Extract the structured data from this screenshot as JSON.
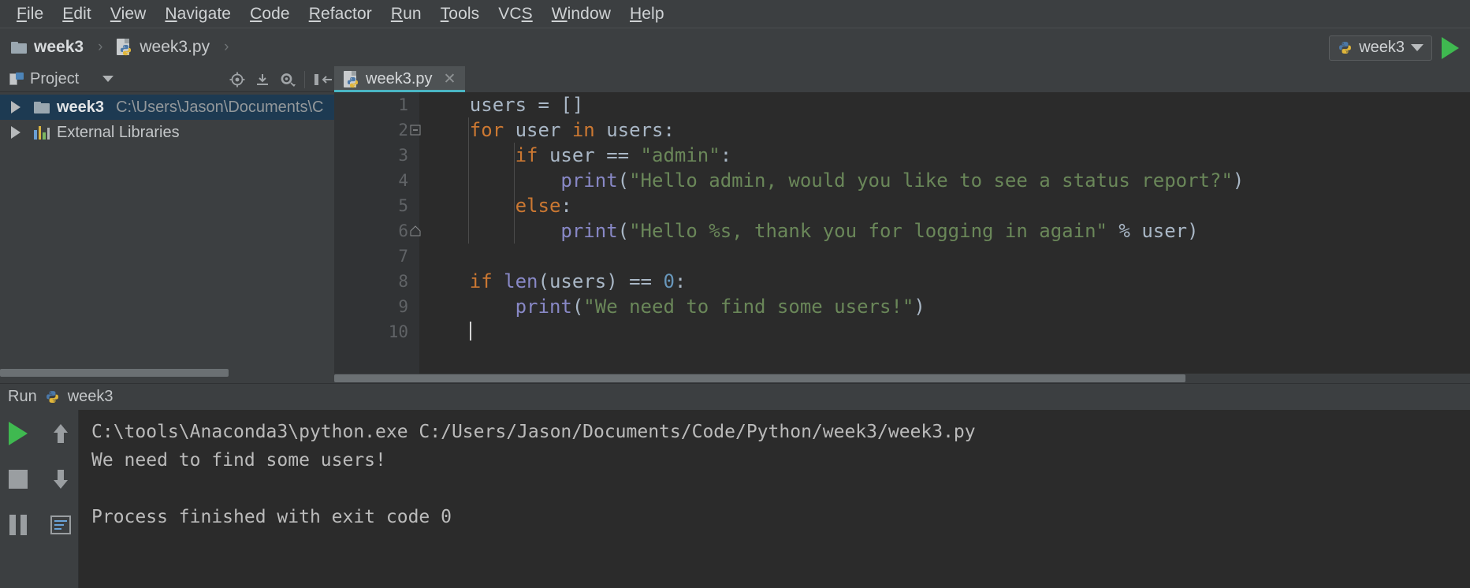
{
  "menubar": {
    "items": [
      {
        "label": "File",
        "mnemonic_index": 0
      },
      {
        "label": "Edit",
        "mnemonic_index": 0
      },
      {
        "label": "View",
        "mnemonic_index": 0
      },
      {
        "label": "Navigate",
        "mnemonic_index": 0
      },
      {
        "label": "Code",
        "mnemonic_index": 0
      },
      {
        "label": "Refactor",
        "mnemonic_index": 0
      },
      {
        "label": "Run",
        "mnemonic_index": 0
      },
      {
        "label": "Tools",
        "mnemonic_index": 0
      },
      {
        "label": "VCS",
        "mnemonic_index": 2
      },
      {
        "label": "Window",
        "mnemonic_index": 0
      },
      {
        "label": "Help",
        "mnemonic_index": 0
      }
    ]
  },
  "breadcrumb": {
    "separator": "›",
    "items": [
      {
        "label": "week3",
        "icon": "folder-icon",
        "bold": true
      },
      {
        "label": "week3.py",
        "icon": "python-file-icon",
        "bold": false
      }
    ]
  },
  "run_config": {
    "name": "week3",
    "icon": "python-icon",
    "dropdown_icon": "chevron-down-icon",
    "run_button_icon": "play-icon",
    "accent_green": "#3fb950"
  },
  "project_panel": {
    "title": "Project",
    "title_icon": "project-icon",
    "dropdown_icon": "chevron-down-icon",
    "toolbar_icons": [
      "locate-target-icon",
      "collapse-all-icon",
      "settings-gear-icon",
      "hide-panel-icon"
    ],
    "tree": [
      {
        "label": "week3",
        "path": "C:\\Users\\Jason\\Documents\\C",
        "icon": "folder-icon",
        "expander": "triangle-right-icon",
        "selected": true,
        "bold": true
      },
      {
        "label": "External Libraries",
        "path": "",
        "icon": "library-icon",
        "expander": "triangle-right-icon",
        "selected": false,
        "bold": false
      }
    ]
  },
  "editor": {
    "tabs": [
      {
        "label": "week3.py",
        "icon": "python-file-icon",
        "active": true,
        "close_icon": "close-icon"
      }
    ],
    "line_numbers": [
      "1",
      "2",
      "3",
      "4",
      "5",
      "6",
      "7",
      "8",
      "9",
      "10"
    ],
    "lines": [
      {
        "n": "1",
        "tokens": [
          {
            "t": "    users = []",
            "c": "plain"
          }
        ]
      },
      {
        "n": "2",
        "tokens": [
          {
            "t": "    ",
            "c": "plain"
          },
          {
            "t": "for",
            "c": "kw"
          },
          {
            "t": " user ",
            "c": "plain"
          },
          {
            "t": "in",
            "c": "kw"
          },
          {
            "t": " users:",
            "c": "plain"
          }
        ]
      },
      {
        "n": "3",
        "tokens": [
          {
            "t": "        ",
            "c": "plain"
          },
          {
            "t": "if",
            "c": "kw"
          },
          {
            "t": " user == ",
            "c": "plain"
          },
          {
            "t": "\"admin\"",
            "c": "str"
          },
          {
            "t": ":",
            "c": "plain"
          }
        ]
      },
      {
        "n": "4",
        "tokens": [
          {
            "t": "            ",
            "c": "plain"
          },
          {
            "t": "print",
            "c": "bif"
          },
          {
            "t": "(",
            "c": "plain"
          },
          {
            "t": "\"Hello admin, would you like to see a status report?\"",
            "c": "str"
          },
          {
            "t": ")",
            "c": "plain"
          }
        ]
      },
      {
        "n": "5",
        "tokens": [
          {
            "t": "        ",
            "c": "plain"
          },
          {
            "t": "else",
            "c": "kw"
          },
          {
            "t": ":",
            "c": "plain"
          }
        ]
      },
      {
        "n": "6",
        "tokens": [
          {
            "t": "            ",
            "c": "plain"
          },
          {
            "t": "print",
            "c": "bif"
          },
          {
            "t": "(",
            "c": "plain"
          },
          {
            "t": "\"Hello %s, thank you for logging in again\"",
            "c": "str"
          },
          {
            "t": " % user)",
            "c": "plain"
          }
        ]
      },
      {
        "n": "7",
        "tokens": [
          {
            "t": "",
            "c": "plain"
          }
        ]
      },
      {
        "n": "8",
        "tokens": [
          {
            "t": "    ",
            "c": "plain"
          },
          {
            "t": "if",
            "c": "kw"
          },
          {
            "t": " ",
            "c": "plain"
          },
          {
            "t": "len",
            "c": "bif"
          },
          {
            "t": "(users) == ",
            "c": "plain"
          },
          {
            "t": "0",
            "c": "num"
          },
          {
            "t": ":",
            "c": "plain"
          }
        ]
      },
      {
        "n": "9",
        "tokens": [
          {
            "t": "        ",
            "c": "plain"
          },
          {
            "t": "print",
            "c": "bif"
          },
          {
            "t": "(",
            "c": "plain"
          },
          {
            "t": "\"We need to find some users!\"",
            "c": "str"
          },
          {
            "t": ")",
            "c": "plain"
          }
        ]
      },
      {
        "n": "10",
        "tokens": [
          {
            "t": "    ",
            "c": "plain"
          }
        ]
      }
    ],
    "colors": {
      "background": "#2b2b2b",
      "gutter": "#313335",
      "plain": "#a9b7c6",
      "keyword": "#cc7832",
      "string": "#6a8759",
      "builtin": "#8888c6",
      "number": "#6897bb",
      "tab_underline": "#4ab6c4"
    },
    "fold_markers": [
      {
        "line": "2",
        "type": "fold-start-icon"
      },
      {
        "line": "6",
        "type": "fold-end-icon"
      }
    ]
  },
  "run_window": {
    "title": "Run",
    "config_name": "week3",
    "config_icon": "python-icon",
    "toolbar_icons": [
      "run-icon",
      "arrow-up-icon",
      "stop-icon",
      "arrow-down-icon",
      "pause-icon",
      "soft-wrap-icon"
    ],
    "console_lines": [
      "C:\\tools\\Anaconda3\\python.exe C:/Users/Jason/Documents/Code/Python/week3/week3.py",
      "We need to find some users!",
      "",
      "Process finished with exit code 0"
    ]
  }
}
